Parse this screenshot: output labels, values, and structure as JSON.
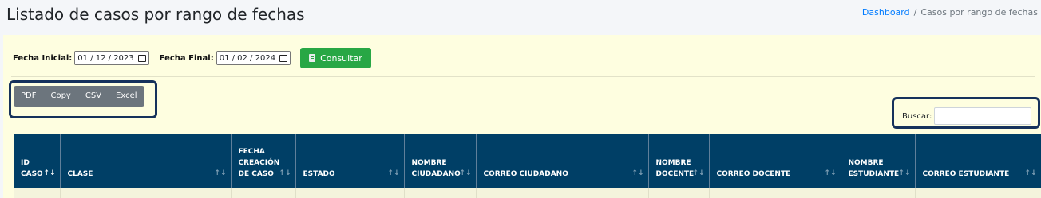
{
  "page": {
    "title": "Listado de casos por rango de fechas",
    "breadcrumb": {
      "link": "Dashboard",
      "separator": "/",
      "current": "Casos por rango de fechas"
    }
  },
  "filters": {
    "start_label": "Fecha Inicial:",
    "start_value": "01 / 12 / 2023",
    "end_label": "Fecha Final:",
    "end_value": "01 / 02 / 2024",
    "submit_label": "Consultar"
  },
  "export_buttons": [
    "PDF",
    "Copy",
    "CSV",
    "Excel"
  ],
  "search": {
    "label": "Buscar:",
    "value": ""
  },
  "table": {
    "columns": [
      {
        "lines": [
          "ID",
          "CASO"
        ]
      },
      {
        "lines": [
          "CLASE"
        ]
      },
      {
        "lines": [
          "FECHA",
          "CREACIÓN",
          "DE CASO"
        ]
      },
      {
        "lines": [
          "ESTADO"
        ]
      },
      {
        "lines": [
          "NOMBRE",
          "CIUDADANO"
        ]
      },
      {
        "lines": [
          "CORREO CIUDADANO"
        ]
      },
      {
        "lines": [
          "NOMBRE",
          "DOCENTE"
        ]
      },
      {
        "lines": [
          "CORREO DOCENTE"
        ]
      },
      {
        "lines": [
          "NOMBRE",
          "ESTUDIANTE"
        ]
      },
      {
        "lines": [
          "CORREO ESTUDIANTE"
        ]
      }
    ],
    "sorted_column": 0,
    "sort_direction": "ascending"
  },
  "colors": {
    "header_bg": "#003f66",
    "panel_bg": "#fefee0",
    "consultar_btn": "#28a745",
    "export_btn": "#6c757d",
    "highlight_border": "#16325c"
  }
}
